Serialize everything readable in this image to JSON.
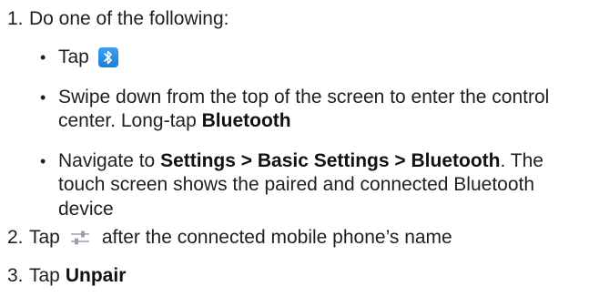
{
  "steps": [
    {
      "number": "1.",
      "text": "Do one of the following:"
    },
    {
      "number": "2.",
      "text_after_icon": "after the connected mobile phone’s name",
      "text_before_icon": "Tap",
      "icon": "sliders-settings-icon"
    },
    {
      "number": "3.",
      "text": "Tap",
      "bold": "Unpair"
    }
  ],
  "bullets": [
    {
      "text": "Tap",
      "icon": "bluetooth-icon"
    },
    {
      "text": "Swipe down from the top of the screen to enter the control center. Long-tap",
      "bold": "Bluetooth"
    },
    {
      "text": "Navigate to",
      "bold": "Settings > Basic Settings > Bluetooth",
      "text_after": ". The touch screen shows the paired and connected Bluetooth device"
    }
  ],
  "colors": {
    "text": "#1f1f1f",
    "bluetooth_icon_bg": "#1a7fdc",
    "sliders_icon": "#9aa0a6"
  }
}
